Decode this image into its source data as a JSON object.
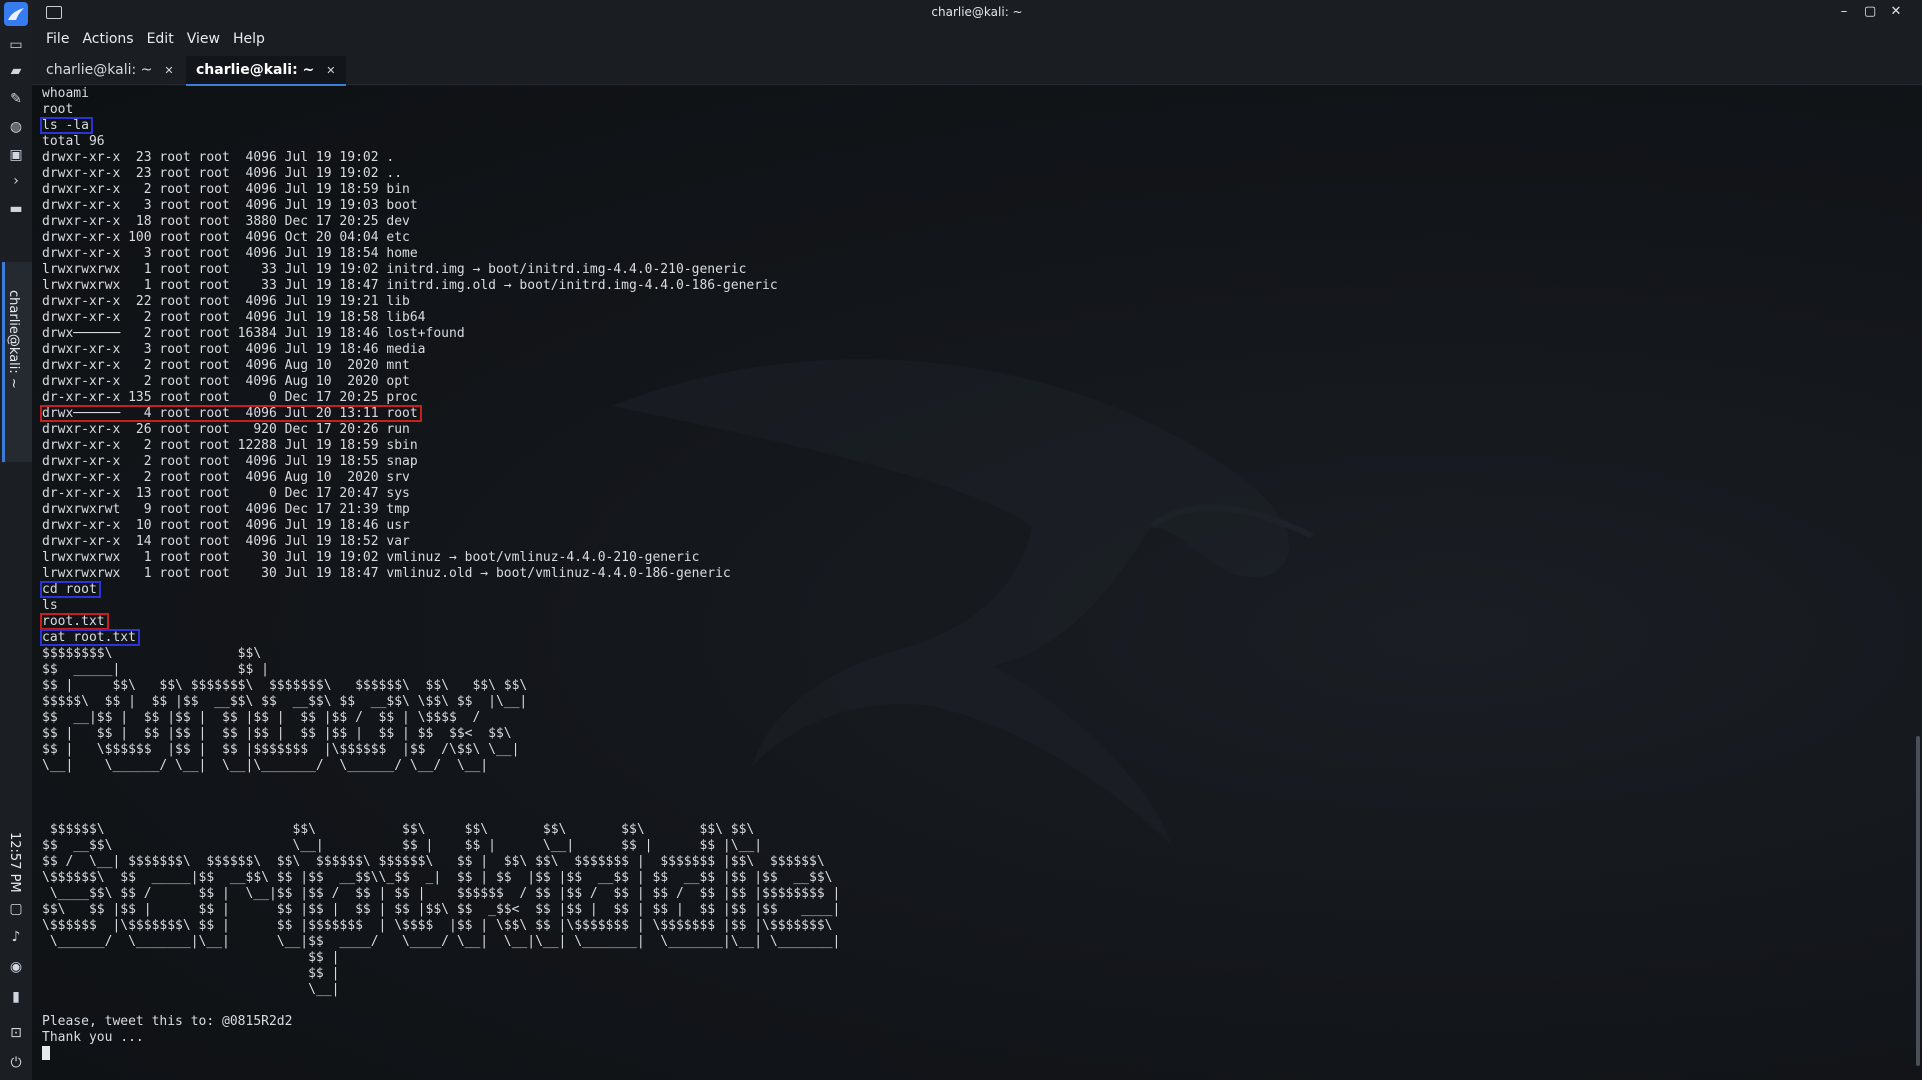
{
  "window": {
    "title": "charlie@kali: ~",
    "controls": {
      "minimize": "–",
      "maximize": "▢",
      "close": "✕"
    }
  },
  "menu": [
    "File",
    "Actions",
    "Edit",
    "View",
    "Help"
  ],
  "tabs": [
    {
      "label": "charlie@kali: ~",
      "close": "✕",
      "active": false
    },
    {
      "label": "charlie@kali: ~",
      "close": "✕",
      "active": true
    }
  ],
  "side_panel": {
    "task_label": "charlie@kali: ~",
    "clock": "12:57 PM",
    "accent_color": "#3b7dd8"
  },
  "terminal": {
    "lines": [
      "whoami",
      "root",
      "ls -la",
      "total 96",
      "drwxr-xr-x  23 root root  4096 Jul 19 19:02 .",
      "drwxr-xr-x  23 root root  4096 Jul 19 19:02 ..",
      "drwxr-xr-x   2 root root  4096 Jul 19 18:59 bin",
      "drwxr-xr-x   3 root root  4096 Jul 19 19:03 boot",
      "drwxr-xr-x  18 root root  3880 Dec 17 20:25 dev",
      "drwxr-xr-x 100 root root  4096 Oct 20 04:04 etc",
      "drwxr-xr-x   3 root root  4096 Jul 19 18:54 home",
      "lrwxrwxrwx   1 root root    33 Jul 19 19:02 initrd.img → boot/initrd.img-4.4.0-210-generic",
      "lrwxrwxrwx   1 root root    33 Jul 19 18:47 initrd.img.old → boot/initrd.img-4.4.0-186-generic",
      "drwxr-xr-x  22 root root  4096 Jul 19 19:21 lib",
      "drwxr-xr-x   2 root root  4096 Jul 19 18:58 lib64",
      "drwx──────   2 root root 16384 Jul 19 18:46 lost+found",
      "drwxr-xr-x   3 root root  4096 Jul 19 18:46 media",
      "drwxr-xr-x   2 root root  4096 Aug 10  2020 mnt",
      "drwxr-xr-x   2 root root  4096 Aug 10  2020 opt",
      "dr-xr-xr-x 135 root root     0 Dec 17 20:25 proc",
      "drwx──────   4 root root  4096 Jul 20 13:11 root",
      "drwxr-xr-x  26 root root   920 Dec 17 20:26 run",
      "drwxr-xr-x   2 root root 12288 Jul 19 18:59 sbin",
      "drwxr-xr-x   2 root root  4096 Jul 19 18:55 snap",
      "drwxr-xr-x   2 root root  4096 Aug 10  2020 srv",
      "dr-xr-xr-x  13 root root     0 Dec 17 20:47 sys",
      "drwxrwxrwt   9 root root  4096 Dec 17 21:39 tmp",
      "drwxr-xr-x  10 root root  4096 Jul 19 18:46 usr",
      "drwxr-xr-x  14 root root  4096 Jul 19 18:52 var",
      "lrwxrwxrwx   1 root root    30 Jul 19 19:02 vmlinuz → boot/vmlinuz-4.4.0-210-generic",
      "lrwxrwxrwx   1 root root    30 Jul 19 18:47 vmlinuz.old → boot/vmlinuz-4.4.0-186-generic",
      "cd root",
      "ls",
      "root.txt",
      "cat root.txt",
      "$$$$$$$$\\                $$\\",
      "$$  _____|               $$ |",
      "$$ |     $$\\   $$\\ $$$$$$$\\  $$$$$$$\\   $$$$$$\\  $$\\   $$\\ $$\\",
      "$$$$$\\  $$ |  $$ |$$  __$$\\ $$  __$$\\ $$  __$$\\ \\$$\\ $$  |\\__|",
      "$$  __|$$ |  $$ |$$ |  $$ |$$ |  $$ |$$ /  $$ | \\$$$$  /",
      "$$ |   $$ |  $$ |$$ |  $$ |$$ |  $$ |$$ |  $$ | $$  $$<  $$\\",
      "$$ |   \\$$$$$$  |$$ |  $$ |$$$$$$$  |\\$$$$$$  |$$  /\\$$\\ \\__|",
      "\\__|    \\______/ \\__|  \\__|\\_______/  \\______/ \\__/  \\__|",
      "",
      "",
      "",
      " $$$$$$\\                        $$\\           $$\\     $$\\       $$\\       $$\\       $$\\ $$\\",
      "$$  __$$\\                       \\__|          $$ |    $$ |      \\__|      $$ |      $$ |\\__|",
      "$$ /  \\__| $$$$$$$\\  $$$$$$\\  $$\\  $$$$$$\\ $$$$$$\\   $$ |  $$\\ $$\\  $$$$$$$ |  $$$$$$$ |$$\\  $$$$$$\\",
      "\\$$$$$$\\  $$  _____|$$  __$$\\ $$ |$$  __$$\\\\_$$  _|  $$ | $$  |$$ |$$  __$$ | $$  __$$ |$$ |$$  __$$\\",
      " \\____$$\\ $$ /      $$ |  \\__|$$ |$$ /  $$ | $$ |    $$$$$$  / $$ |$$ /  $$ | $$ /  $$ |$$ |$$$$$$$$ |",
      "$$\\   $$ |$$ |      $$ |      $$ |$$ |  $$ | $$ |$$\\ $$  _$$<  $$ |$$ |  $$ | $$ |  $$ |$$ |$$   ____|",
      "\\$$$$$$  |\\$$$$$$$\\ $$ |      $$ |$$$$$$$  | \\$$$$  |$$ | \\$$\\ $$ |\\$$$$$$$ | \\$$$$$$$ |$$ |\\$$$$$$$\\",
      " \\______/  \\_______|\\__|      \\__|$$  ____/   \\____/ \\__|  \\__|\\__| \\_______|  \\_______|\\__| \\_______|",
      "                                  $$ |",
      "                                  $$ |",
      "                                  \\__|",
      "",
      "Please, tweet this to: @0815R2d2",
      "Thank you ...",
      ""
    ]
  }
}
